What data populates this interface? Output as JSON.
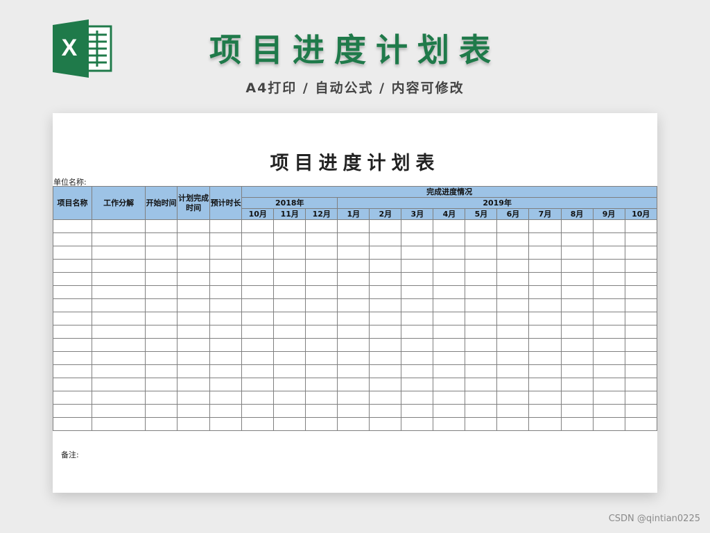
{
  "banner": {
    "logo_icon": "excel-icon",
    "title": "项目进度计划表",
    "subtitle": "A4打印 / 自动公式 / 内容可修改",
    "title_color": "#1f7a4a"
  },
  "sheet": {
    "title": "项目进度计划表",
    "unit_label": "单位名称:",
    "header_color": "#9dc3e6",
    "columns": {
      "project_name": "项目名称",
      "work_breakdown": "工作分解",
      "start_time": "开始时间",
      "planned_finish": "计划完成时间",
      "est_duration": "预计时长",
      "progress_group": "完成进度情况"
    },
    "years": [
      "2018年",
      "2019年"
    ],
    "months_2018": [
      "10月",
      "11月",
      "12月"
    ],
    "months_2019": [
      "1月",
      "2月",
      "3月",
      "4月",
      "5月",
      "6月",
      "7月",
      "8月",
      "9月",
      "10月"
    ],
    "note_label": "备注:"
  },
  "watermark": "CSDN @qintian0225"
}
